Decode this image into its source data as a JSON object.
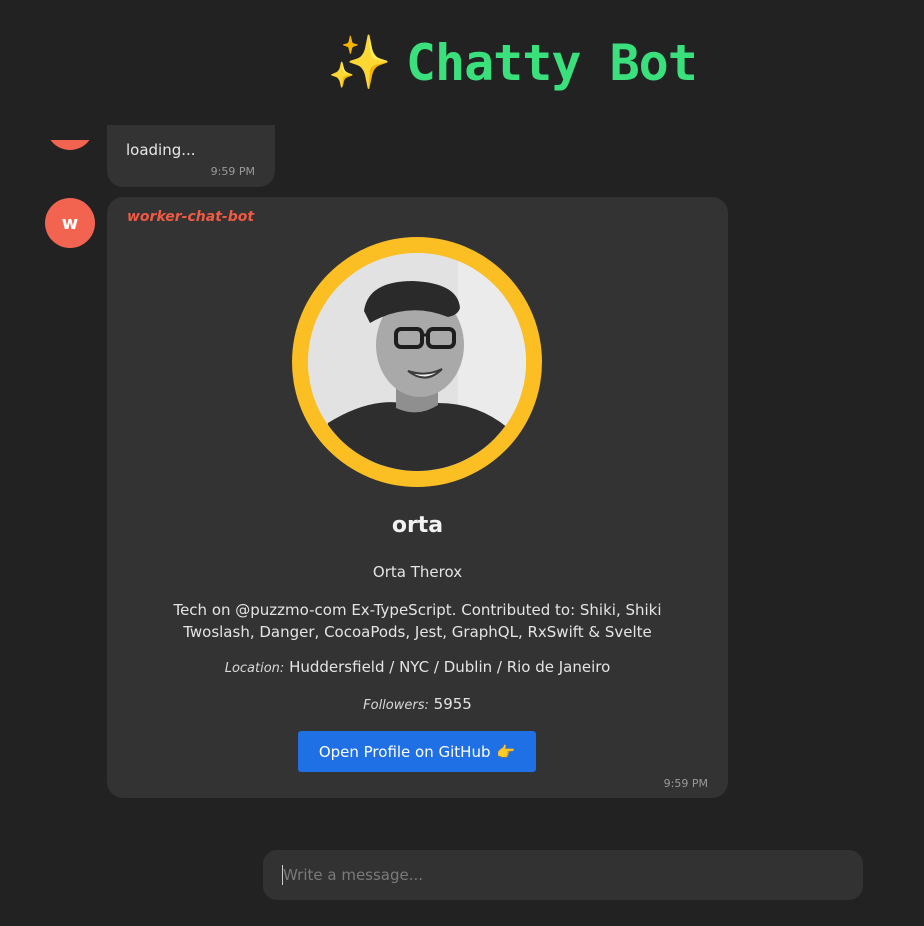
{
  "header": {
    "icon": "sparkles-icon",
    "sparkle_glyph": "✨",
    "title": "Chatty Bot",
    "title_color": "#39e07c"
  },
  "previous_message": {
    "text": "loading...",
    "time": "9:59 PM"
  },
  "message": {
    "avatar_initial": "w",
    "avatar_color": "#f26450",
    "sender": "worker-chat-bot",
    "time": "9:59 PM",
    "profile": {
      "username": "orta",
      "full_name": "Orta Therox",
      "bio": "Tech on @puzzmo-com Ex-TypeScript. Contributed to: Shiki, Shiki Twoslash, Danger, CocoaPods, Jest, GraphQL, RxSwift & Svelte",
      "location_label": "Location:",
      "location": "Huddersfield / NYC / Dublin / Rio de Janeiro",
      "followers_label": "Followers:",
      "followers": "5955",
      "ring_color": "#fbbf24",
      "button_label": "Open Profile on GitHub",
      "button_emoji": "👉",
      "button_color": "#1f6fe5"
    }
  },
  "composer": {
    "placeholder": "Write a message...",
    "value": ""
  }
}
